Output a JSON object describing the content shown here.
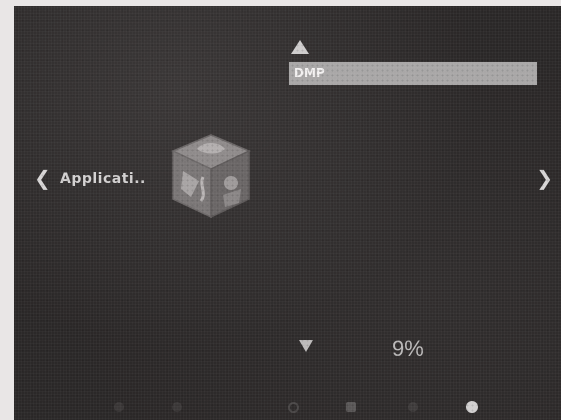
{
  "screen": {
    "navigation": {
      "prev_glyph": "❮",
      "next_glyph": "❯",
      "category_label": "Applicati.."
    },
    "app_icon": "application-box-icon",
    "list": {
      "items": [
        {
          "label": "DMP",
          "selected": true
        }
      ]
    },
    "progress": {
      "text": "9%",
      "value": 0.09
    },
    "bottom_bar": {
      "icons": [
        "home-icon",
        "settings-icon",
        "network-icon",
        "grid-icon",
        "info-icon",
        "power-icon"
      ]
    },
    "colors": {
      "background": "#2b2828",
      "highlight": "#a9a7a7",
      "text": "#d3d1d1"
    }
  }
}
